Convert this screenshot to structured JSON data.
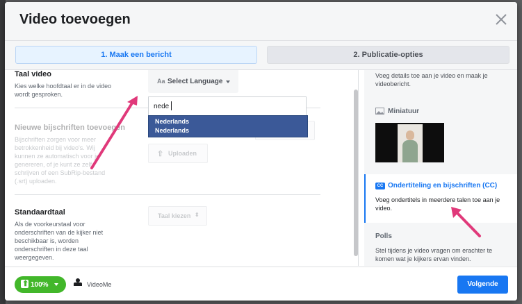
{
  "modal": {
    "title": "Video toevoegen",
    "steps": [
      {
        "label": "1. Maak een bericht",
        "active": true
      },
      {
        "label": "2. Publicatie-opties",
        "active": false
      }
    ]
  },
  "language_section": {
    "title": "Taal video",
    "description": "Kies welke hoofdtaal er in de video wordt gesproken.",
    "select_label": "Select Language",
    "search_value": "nede",
    "options": [
      "Nederlands",
      "Nederlands"
    ]
  },
  "captions_section": {
    "title": "Nieuwe bijschriften toevoegen",
    "description": "Bijschriften zorgen voor meer betrokkenheid bij video's. Wij kunnen ze automatisch voor je genereren, of je kunt ze zelf schrijven of een SubRip-bestand (.srt) uploaden.",
    "upload_label": "Uploaden"
  },
  "default_language_section": {
    "title": "Standaardtaal",
    "description": "Als de voorkeurstaal voor onderschriften van de kijker niet beschikbaar is, worden onderschriften in deze taal weergegeven.",
    "select_label": "Taal kiezen"
  },
  "sidebar": {
    "intro": "Voeg details toe aan je video en maak je videobericht.",
    "thumbnail_title": "Miniatuur",
    "captions_title": "Ondertiteling en bijschriften (CC)",
    "captions_badge": "CC",
    "captions_desc": "Voeg ondertitels in meerdere talen toe aan je video.",
    "polls_title": "Polls",
    "polls_desc": "Stel tijdens je video vragen om erachter te komen wat je kijkers ervan vinden."
  },
  "footer": {
    "progress": "100%",
    "uploader": "VideoMe",
    "next_label": "Volgende"
  },
  "colors": {
    "accent": "#1877f2",
    "success": "#42b72a",
    "annotation": "#e0397a",
    "dropdown_highlight": "#3b5998"
  }
}
